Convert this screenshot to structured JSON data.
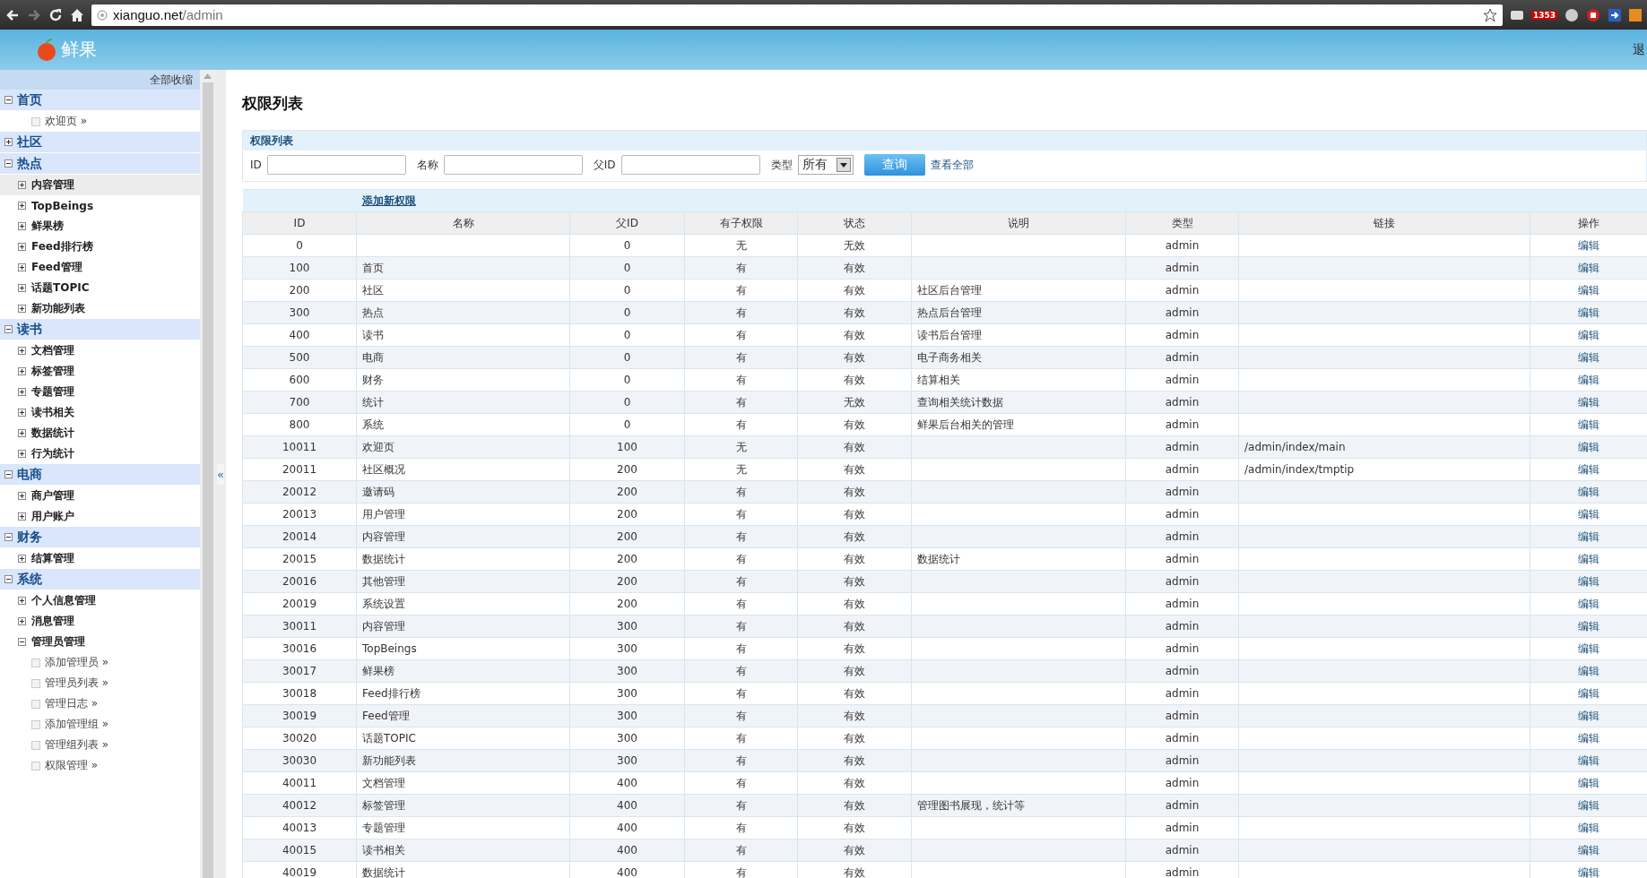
{
  "browser": {
    "url_host": "xianguo.net",
    "url_path": "/admin",
    "badge": "1353"
  },
  "header": {
    "logo": "鲜果",
    "right_text": "退"
  },
  "sidebar": {
    "collapse_all": "全部收缩",
    "collapse_handle": "«",
    "groups": [
      {
        "label": "首页",
        "expanded": true,
        "items": [
          {
            "kind": "page",
            "label": "欢迎页 »",
            "selected": false
          }
        ]
      },
      {
        "label": "社区",
        "expanded": false
      },
      {
        "label": "热点",
        "expanded": true,
        "items": [
          {
            "kind": "folder",
            "label": "内容管理",
            "expanded": false,
            "selected": true
          },
          {
            "kind": "folder",
            "label": "TopBeings",
            "expanded": false,
            "selected": false
          },
          {
            "kind": "folder",
            "label": "鲜果榜",
            "expanded": false,
            "selected": false
          },
          {
            "kind": "folder",
            "label": "Feed排行榜",
            "expanded": false,
            "selected": false
          },
          {
            "kind": "folder",
            "label": "Feed管理",
            "expanded": false,
            "selected": false
          },
          {
            "kind": "folder",
            "label": "话题TOPIC",
            "expanded": false,
            "selected": false
          },
          {
            "kind": "folder",
            "label": "新功能列表",
            "expanded": false,
            "selected": false
          }
        ]
      },
      {
        "label": "读书",
        "expanded": true,
        "items": [
          {
            "kind": "folder",
            "label": "文档管理",
            "expanded": false,
            "selected": false
          },
          {
            "kind": "folder",
            "label": "标签管理",
            "expanded": false,
            "selected": false
          },
          {
            "kind": "folder",
            "label": "专题管理",
            "expanded": false,
            "selected": false
          },
          {
            "kind": "folder",
            "label": "读书相关",
            "expanded": false,
            "selected": false
          },
          {
            "kind": "folder",
            "label": "数据统计",
            "expanded": false,
            "selected": false
          },
          {
            "kind": "folder",
            "label": "行为统计",
            "expanded": false,
            "selected": false
          }
        ]
      },
      {
        "label": "电商",
        "expanded": true,
        "items": [
          {
            "kind": "folder",
            "label": "商户管理",
            "expanded": false,
            "selected": false
          },
          {
            "kind": "folder",
            "label": "用户账户",
            "expanded": false,
            "selected": false
          }
        ]
      },
      {
        "label": "财务",
        "expanded": true,
        "items": [
          {
            "kind": "folder",
            "label": "结算管理",
            "expanded": false,
            "selected": false
          }
        ]
      },
      {
        "label": "系统",
        "expanded": true,
        "items": [
          {
            "kind": "folder",
            "label": "个人信息管理",
            "expanded": false,
            "selected": false
          },
          {
            "kind": "folder",
            "label": "消息管理",
            "expanded": false,
            "selected": false
          },
          {
            "kind": "folder",
            "label": "管理员管理",
            "expanded": true,
            "selected": false,
            "children": [
              {
                "kind": "page",
                "label": "添加管理员 »",
                "selected": false
              },
              {
                "kind": "page",
                "label": "管理员列表 »",
                "selected": false
              },
              {
                "kind": "page",
                "label": "管理日志 »",
                "selected": false
              },
              {
                "kind": "page",
                "label": "添加管理组 »",
                "selected": false
              },
              {
                "kind": "page",
                "label": "管理组列表 »",
                "selected": false
              },
              {
                "kind": "page",
                "label": "权限管理 »",
                "selected": false
              }
            ]
          }
        ]
      }
    ]
  },
  "page": {
    "title": "权限列表"
  },
  "filter": {
    "title": "权限列表",
    "fields": [
      {
        "label": "ID"
      },
      {
        "label": "名称"
      },
      {
        "label": "父ID"
      }
    ],
    "type_label": "类型",
    "type_value": "所有",
    "query_button": "查询",
    "view_all": "查看全部"
  },
  "table": {
    "add_link": "添加新权限",
    "columns": [
      "ID",
      "名称",
      "父ID",
      "有子权限",
      "状态",
      "说明",
      "类型",
      "链接",
      "操作"
    ],
    "rows": [
      [
        "0",
        "",
        "0",
        "无",
        "无效",
        "",
        "admin",
        "",
        "编辑"
      ],
      [
        "100",
        "首页",
        "0",
        "有",
        "有效",
        "",
        "admin",
        "",
        "编辑"
      ],
      [
        "200",
        "社区",
        "0",
        "有",
        "有效",
        "社区后台管理",
        "admin",
        "",
        "编辑"
      ],
      [
        "300",
        "热点",
        "0",
        "有",
        "有效",
        "热点后台管理",
        "admin",
        "",
        "编辑"
      ],
      [
        "400",
        "读书",
        "0",
        "有",
        "有效",
        "读书后台管理",
        "admin",
        "",
        "编辑"
      ],
      [
        "500",
        "电商",
        "0",
        "有",
        "有效",
        "电子商务相关",
        "admin",
        "",
        "编辑"
      ],
      [
        "600",
        "财务",
        "0",
        "有",
        "有效",
        "结算相关",
        "admin",
        "",
        "编辑"
      ],
      [
        "700",
        "统计",
        "0",
        "有",
        "无效",
        "查询相关统计数据",
        "admin",
        "",
        "编辑"
      ],
      [
        "800",
        "系统",
        "0",
        "有",
        "有效",
        "鲜果后台相关的管理",
        "admin",
        "",
        "编辑"
      ],
      [
        "10011",
        "欢迎页",
        "100",
        "无",
        "有效",
        "",
        "admin",
        "/admin/index/main",
        "编辑"
      ],
      [
        "20011",
        "社区概况",
        "200",
        "无",
        "有效",
        "",
        "admin",
        "/admin/index/tmptip",
        "编辑"
      ],
      [
        "20012",
        "邀请码",
        "200",
        "有",
        "有效",
        "",
        "admin",
        "",
        "编辑"
      ],
      [
        "20013",
        "用户管理",
        "200",
        "有",
        "有效",
        "",
        "admin",
        "",
        "编辑"
      ],
      [
        "20014",
        "内容管理",
        "200",
        "有",
        "有效",
        "",
        "admin",
        "",
        "编辑"
      ],
      [
        "20015",
        "数据统计",
        "200",
        "有",
        "有效",
        "数据统计",
        "admin",
        "",
        "编辑"
      ],
      [
        "20016",
        "其他管理",
        "200",
        "有",
        "有效",
        "",
        "admin",
        "",
        "编辑"
      ],
      [
        "20019",
        "系统设置",
        "200",
        "有",
        "有效",
        "",
        "admin",
        "",
        "编辑"
      ],
      [
        "30011",
        "内容管理",
        "300",
        "有",
        "有效",
        "",
        "admin",
        "",
        "编辑"
      ],
      [
        "30016",
        "TopBeings",
        "300",
        "有",
        "有效",
        "",
        "admin",
        "",
        "编辑"
      ],
      [
        "30017",
        "鲜果榜",
        "300",
        "有",
        "有效",
        "",
        "admin",
        "",
        "编辑"
      ],
      [
        "30018",
        "Feed排行榜",
        "300",
        "有",
        "有效",
        "",
        "admin",
        "",
        "编辑"
      ],
      [
        "30019",
        "Feed管理",
        "300",
        "有",
        "有效",
        "",
        "admin",
        "",
        "编辑"
      ],
      [
        "30020",
        "话题TOPIC",
        "300",
        "有",
        "有效",
        "",
        "admin",
        "",
        "编辑"
      ],
      [
        "30030",
        "新功能列表",
        "300",
        "有",
        "有效",
        "",
        "admin",
        "",
        "编辑"
      ],
      [
        "40011",
        "文档管理",
        "400",
        "有",
        "有效",
        "",
        "admin",
        "",
        "编辑"
      ],
      [
        "40012",
        "标签管理",
        "400",
        "有",
        "有效",
        "管理图书展现，统计等",
        "admin",
        "",
        "编辑"
      ],
      [
        "40013",
        "专题管理",
        "400",
        "有",
        "有效",
        "",
        "admin",
        "",
        "编辑"
      ],
      [
        "40015",
        "读书相关",
        "400",
        "有",
        "有效",
        "",
        "admin",
        "",
        "编辑"
      ],
      [
        "40019",
        "数据统计",
        "400",
        "有",
        "有效",
        "",
        "admin",
        "",
        "编辑"
      ]
    ]
  }
}
